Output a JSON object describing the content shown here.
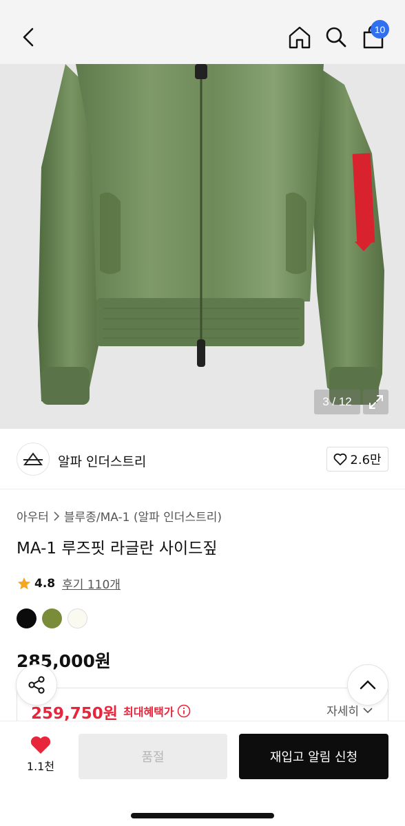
{
  "header": {
    "back_icon": "chevron-left-icon",
    "home_icon": "home-icon",
    "search_icon": "search-icon",
    "cart_icon": "shopping-bag-icon",
    "cart_count": "10"
  },
  "gallery": {
    "counter": "3 / 12",
    "expand_icon": "expand-icon",
    "image_subject": "green bomber jacket"
  },
  "brand": {
    "name": "알파 인더스트리",
    "likes": "2.6만"
  },
  "product": {
    "breadcrumb_category": "아우터",
    "breadcrumb_subcategory": "블루종/MA-1 (알파 인더스트리)",
    "title": "MA-1 루즈핏 라글란 사이드짚",
    "rating": "4.8",
    "reviews": "후기 110개",
    "colors": [
      "#0b0b0b",
      "#7a8b3a",
      "#fafaf0"
    ],
    "price": "285,000원",
    "sale_price": "259,750원",
    "max_benefit_label": "최대혜택가",
    "detail_label": "자세히"
  },
  "bottom": {
    "wish_count": "1.1천",
    "soldout_label": "품절",
    "restock_label": "재입고 알림 신청"
  },
  "colors": {
    "sale": "#e8263b",
    "badge": "#2f6ff0",
    "star": "#f5a623",
    "heart": "#e8263b"
  }
}
